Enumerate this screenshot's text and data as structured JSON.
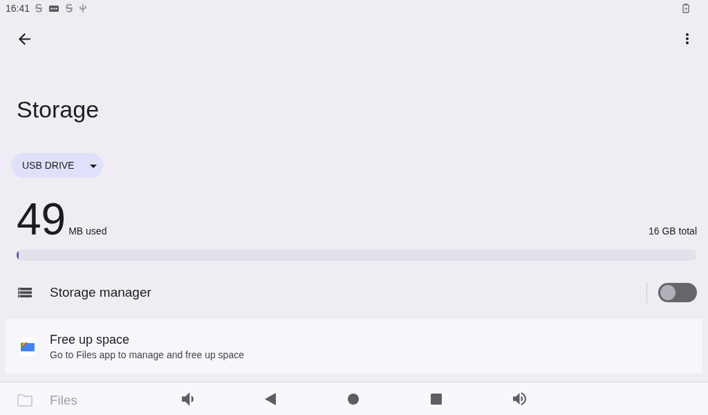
{
  "status_bar": {
    "time": "16:41"
  },
  "page_title": "Storage",
  "storage_selector": {
    "label": "USB DRIVE"
  },
  "usage": {
    "used_amount": "49",
    "used_unit": "MB used",
    "total": "16 GB total",
    "level": 0.003
  },
  "settings": [
    {
      "kind": "toggle",
      "label": "Storage manager",
      "on": false
    },
    {
      "kind": "action",
      "title": "Free up space",
      "subtitle": "Go to Files app to manage and free up space"
    }
  ],
  "categories": [
    {
      "label": "Files"
    }
  ]
}
